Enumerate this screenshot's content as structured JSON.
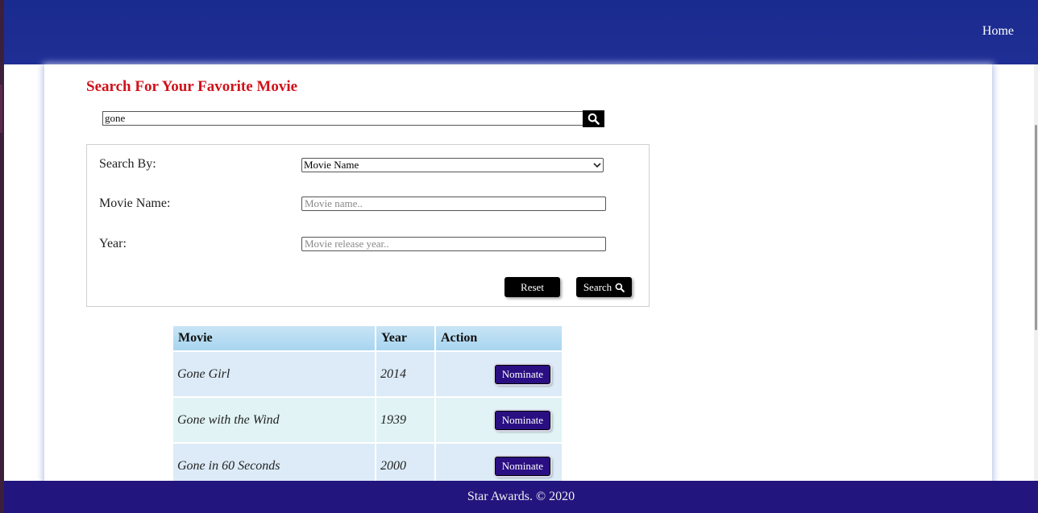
{
  "header": {
    "home_label": "Home"
  },
  "main": {
    "title": "Search For Your Favorite Movie",
    "quick_search": {
      "value": "gone",
      "icon": "search-icon"
    }
  },
  "search_form": {
    "search_by_label": "Search By:",
    "search_by_selected": "Movie Name",
    "movie_name_label": "Movie Name:",
    "movie_name_placeholder": "Movie name..",
    "year_label": "Year:",
    "year_placeholder": "Movie release year..",
    "reset_label": "Reset",
    "search_label": "Search"
  },
  "results": {
    "headers": [
      "Movie",
      "Year",
      "Action"
    ],
    "rows": [
      {
        "movie": "Gone Girl",
        "year": "2014",
        "action": "Nominate"
      },
      {
        "movie": "Gone with the Wind",
        "year": "1939",
        "action": "Nominate"
      },
      {
        "movie": "Gone in 60 Seconds",
        "year": "2000",
        "action": "Nominate"
      }
    ]
  },
  "footer": {
    "text": "Star Awards. © 2020"
  },
  "colors": {
    "header": "#1a2b8f",
    "footer": "#22157e",
    "title": "#d0121b",
    "nominate": "#2a0f82"
  }
}
